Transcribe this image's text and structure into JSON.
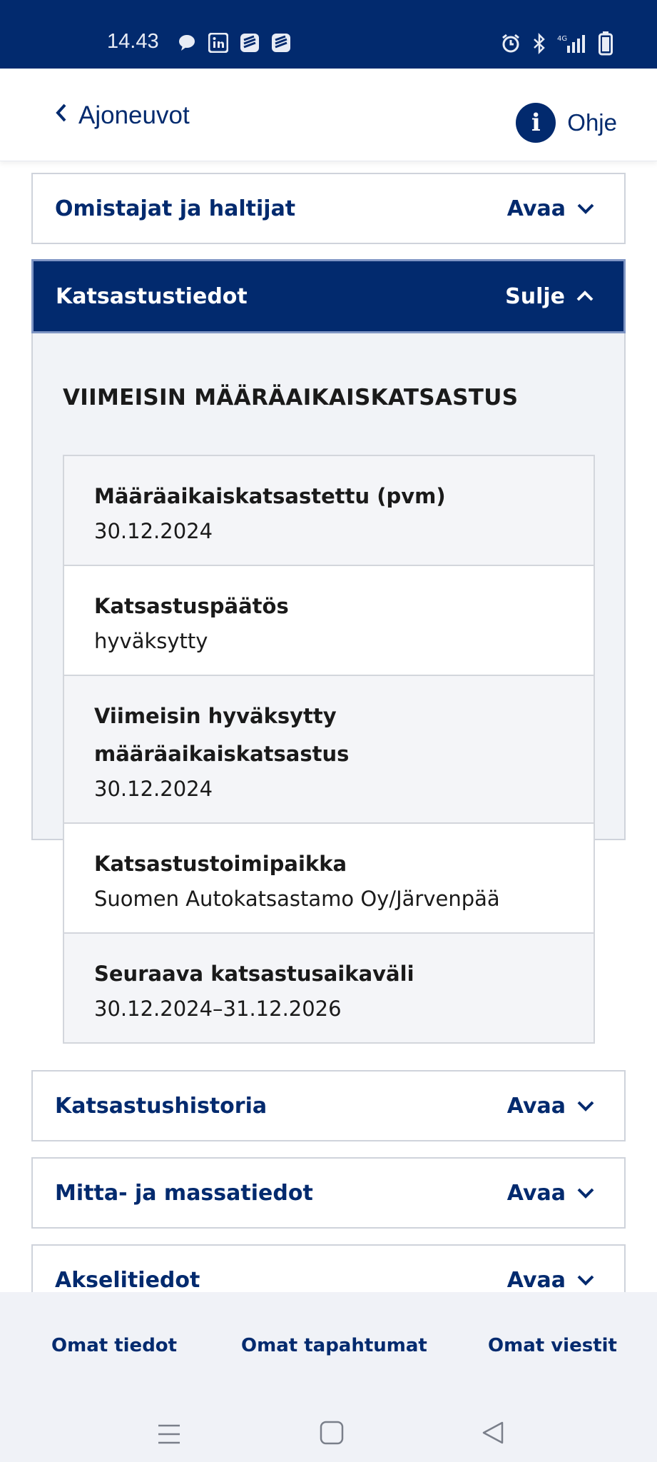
{
  "status_bar": {
    "time": "14.43",
    "left_icons": [
      "chat-bubble-icon",
      "linkedin-icon",
      "app-icon",
      "app-icon"
    ],
    "right_icons": [
      "alarm-icon",
      "bluetooth-icon",
      "4g-signal-icon",
      "battery-icon"
    ],
    "network": "4G"
  },
  "header": {
    "back_label": "Ajoneuvot",
    "help_label": "Ohje",
    "help_icon_glyph": "i"
  },
  "accordions": {
    "owners": {
      "title": "Omistajat ja haltijat",
      "action": "Avaa"
    },
    "inspection": {
      "title": "Katsastustiedot",
      "action": "Sulje"
    },
    "history": {
      "title": "Katsastushistoria",
      "action": "Avaa"
    },
    "dimensions": {
      "title": "Mitta- ja massatiedot",
      "action": "Avaa"
    },
    "axles": {
      "title": "Akselitiedot",
      "action": "Avaa"
    }
  },
  "inspection_panel": {
    "heading": "VIIMEISIN MÄÄRÄAIKAISKATSASTUS",
    "rows": [
      {
        "label": "Määräaikaiskatsastettu (pvm)",
        "value": "30.12.2024"
      },
      {
        "label": "Katsastuspäätös",
        "value": "hyväksytty"
      },
      {
        "label": "Viimeisin hyväksytty määräaikaiskatsastus",
        "value": "30.12.2024"
      },
      {
        "label": "Katsastustoimipaikka",
        "value": "Suomen Autokatsastamo Oy/Järvenpää"
      },
      {
        "label": "Seuraava katsastusaikaväli",
        "value": "30.12.2024–31.12.2026"
      }
    ]
  },
  "bottom_nav": {
    "items": [
      {
        "label": "Omat tiedot"
      },
      {
        "label": "Omat tapahtumat"
      },
      {
        "label": "Omat viestit"
      }
    ]
  },
  "colors": {
    "brand_navy": "#022a6e",
    "panel_bg": "#f1f3f7",
    "border": "#cfd3db"
  }
}
